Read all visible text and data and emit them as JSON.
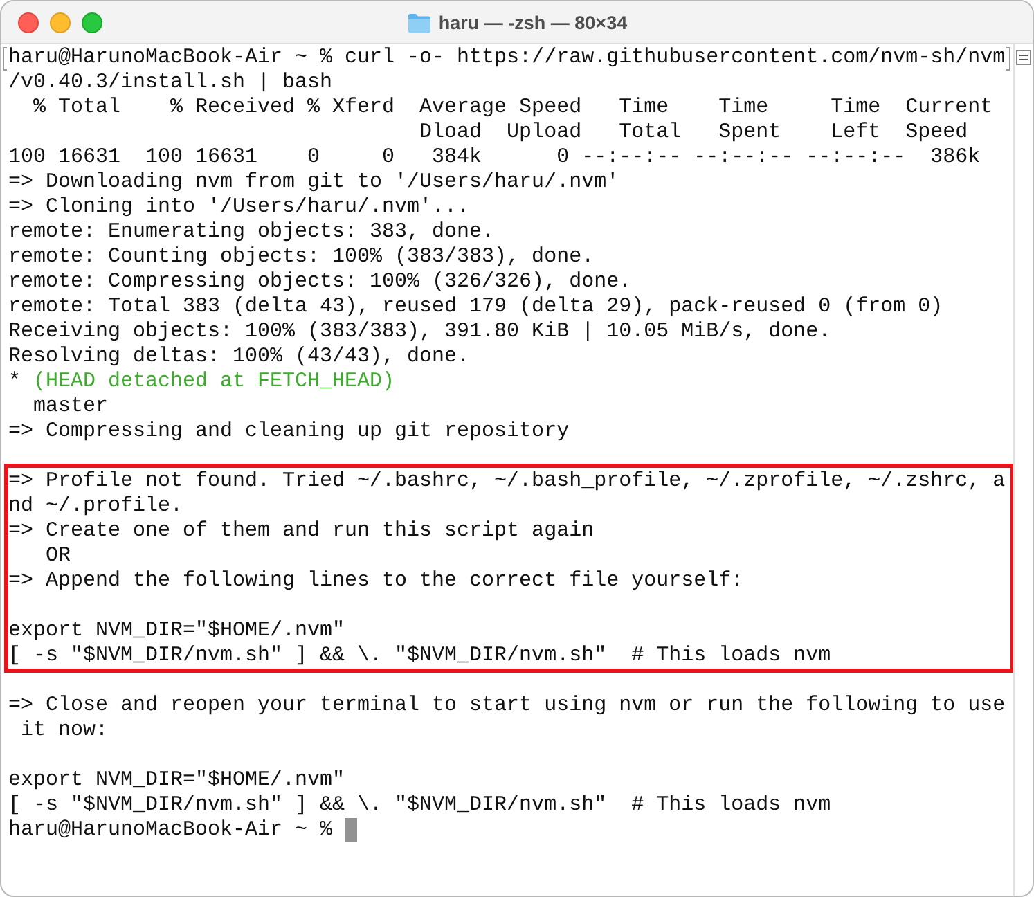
{
  "window": {
    "title": "haru — -zsh — 80×34"
  },
  "blocks": [
    {
      "highlighted": false,
      "lines": [
        {
          "kind": "text",
          "marked": true,
          "text": "haru@HarunoMacBook-Air ~ % curl -o- https://raw.githubusercontent.com/nvm-sh/nvm"
        },
        {
          "kind": "text",
          "text": "/v0.40.3/install.sh | bash"
        },
        {
          "kind": "text",
          "text": "  % Total    % Received % Xferd  Average Speed   Time    Time     Time  Current"
        },
        {
          "kind": "text",
          "text": "                                 Dload  Upload   Total   Spent    Left  Speed"
        },
        {
          "kind": "text",
          "text": "100 16631  100 16631    0     0   384k      0 --:--:-- --:--:-- --:--:--  386k"
        },
        {
          "kind": "text",
          "text": "=> Downloading nvm from git to '/Users/haru/.nvm'"
        },
        {
          "kind": "text",
          "text": "=> Cloning into '/Users/haru/.nvm'..."
        },
        {
          "kind": "text",
          "text": "remote: Enumerating objects: 383, done."
        },
        {
          "kind": "text",
          "text": "remote: Counting objects: 100% (383/383), done."
        },
        {
          "kind": "text",
          "text": "remote: Compressing objects: 100% (326/326), done."
        },
        {
          "kind": "text",
          "text": "remote: Total 383 (delta 43), reused 179 (delta 29), pack-reused 0 (from 0)"
        },
        {
          "kind": "text",
          "text": "Receiving objects: 100% (383/383), 391.80 KiB | 10.05 MiB/s, done."
        },
        {
          "kind": "text",
          "text": "Resolving deltas: 100% (43/43), done."
        },
        {
          "kind": "text",
          "text": "* ",
          "accent": "(HEAD detached at FETCH_HEAD)"
        },
        {
          "kind": "text",
          "text": "  master"
        },
        {
          "kind": "text",
          "text": "=> Compressing and cleaning up git repository"
        },
        {
          "kind": "blank"
        }
      ]
    },
    {
      "highlighted": true,
      "lines": [
        {
          "kind": "text",
          "text": "=> Profile not found. Tried ~/.bashrc, ~/.bash_profile, ~/.zprofile, ~/.zshrc, a"
        },
        {
          "kind": "text",
          "text": "nd ~/.profile."
        },
        {
          "kind": "text",
          "text": "=> Create one of them and run this script again"
        },
        {
          "kind": "text",
          "text": "   OR"
        },
        {
          "kind": "text",
          "text": "=> Append the following lines to the correct file yourself:"
        },
        {
          "kind": "blank"
        },
        {
          "kind": "text",
          "text": "export NVM_DIR=\"$HOME/.nvm\""
        },
        {
          "kind": "text",
          "text": "[ -s \"$NVM_DIR/nvm.sh\" ] && \\. \"$NVM_DIR/nvm.sh\"  # This loads nvm"
        }
      ]
    },
    {
      "highlighted": false,
      "lines": [
        {
          "kind": "blank"
        },
        {
          "kind": "text",
          "text": "=> Close and reopen your terminal to start using nvm or run the following to use"
        },
        {
          "kind": "text",
          "text": " it now:"
        },
        {
          "kind": "blank"
        },
        {
          "kind": "text",
          "text": "export NVM_DIR=\"$HOME/.nvm\""
        },
        {
          "kind": "text",
          "text": "[ -s \"$NVM_DIR/nvm.sh\" ] && \\. \"$NVM_DIR/nvm.sh\"  # This loads nvm"
        },
        {
          "kind": "text",
          "text": "haru@HarunoMacBook-Air ~ %",
          "cursor": true
        }
      ]
    }
  ]
}
